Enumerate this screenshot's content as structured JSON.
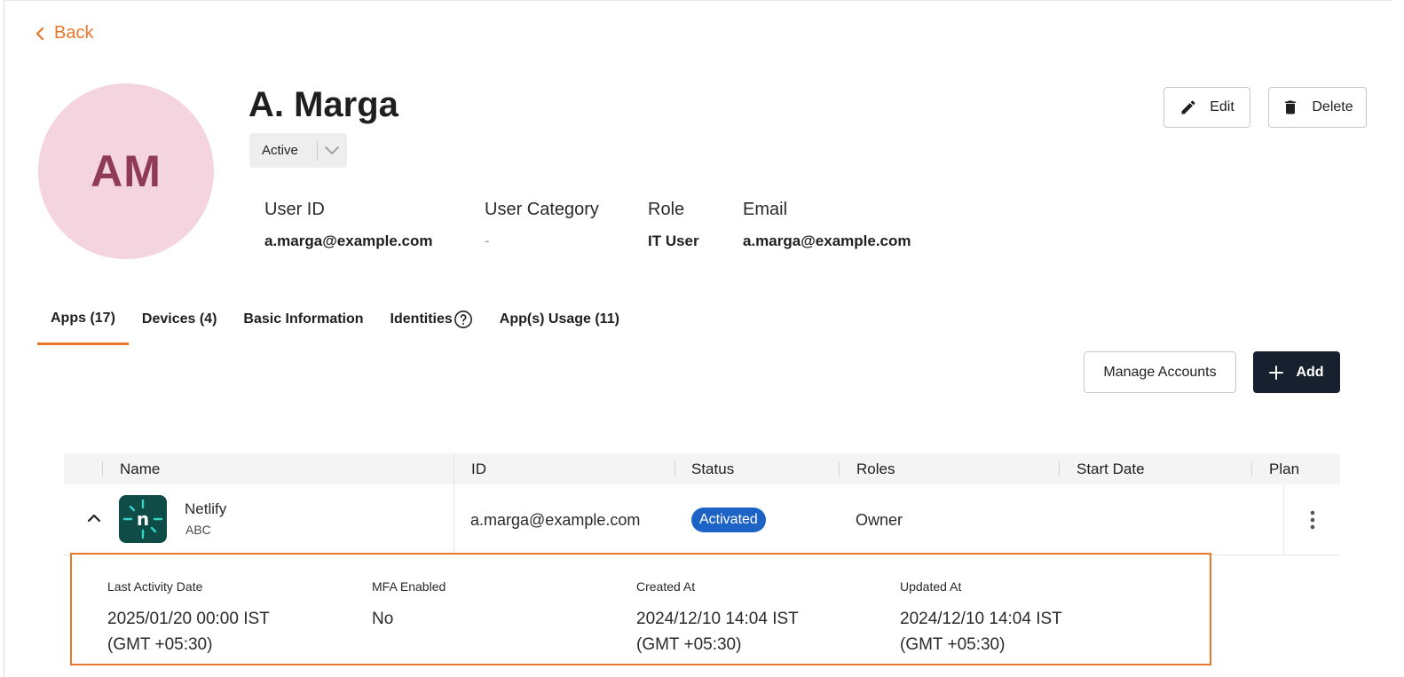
{
  "nav": {
    "back_label": "Back"
  },
  "user": {
    "initials": "AM",
    "name": "A. Marga",
    "status": "Active",
    "fields": [
      {
        "label": "User ID",
        "value": "a.marga@example.com"
      },
      {
        "label": "User Category",
        "value": "-"
      },
      {
        "label": "Role",
        "value": "IT User"
      },
      {
        "label": "Email",
        "value": "a.marga@example.com"
      }
    ]
  },
  "actions": {
    "edit_label": "Edit",
    "delete_label": "Delete"
  },
  "tabs": [
    {
      "label": "Apps (17)",
      "active": true
    },
    {
      "label": "Devices (4)",
      "active": false
    },
    {
      "label": "Basic Information",
      "active": false
    },
    {
      "label": "Identities",
      "active": false
    },
    {
      "label": "App(s) Usage (11)",
      "active": false
    }
  ],
  "toolbar": {
    "manage_label": "Manage Accounts",
    "add_label": "Add"
  },
  "table": {
    "columns": [
      "Name",
      "ID",
      "Status",
      "Roles",
      "Start Date",
      "Plan"
    ],
    "rows": [
      {
        "app_name": "Netlify",
        "app_org": "ABC",
        "app_logo_letter": "n",
        "id": "a.marga@example.com",
        "status": "Activated",
        "roles": "Owner",
        "start_date": "",
        "plan": "",
        "details": [
          {
            "label": "Last Activity Date",
            "value_line1": "2025/01/20 00:00 IST",
            "value_line2": "(GMT +05:30)"
          },
          {
            "label": "MFA Enabled",
            "value_line1": "No",
            "value_line2": ""
          },
          {
            "label": "Created At",
            "value_line1": "2024/12/10 14:04 IST",
            "value_line2": "(GMT +05:30)"
          },
          {
            "label": "Updated At",
            "value_line1": "2024/12/10 14:04 IST",
            "value_line2": "(GMT +05:30)"
          }
        ]
      }
    ]
  },
  "colors": {
    "accent": "#e8772b",
    "primary_button": "#17202e",
    "status_badge": "#1d63c6",
    "avatar_bg": "#f4d4df",
    "avatar_text": "#8f3b57"
  },
  "icons": {
    "back": "chevron-left-icon",
    "status_dropdown": "chevron-down-icon",
    "edit": "pencil-icon",
    "delete": "trash-icon",
    "identities_help": "question-circle-icon",
    "add": "plus-icon",
    "expand": "chevron-up-icon",
    "row_menu": "kebab-icon"
  }
}
